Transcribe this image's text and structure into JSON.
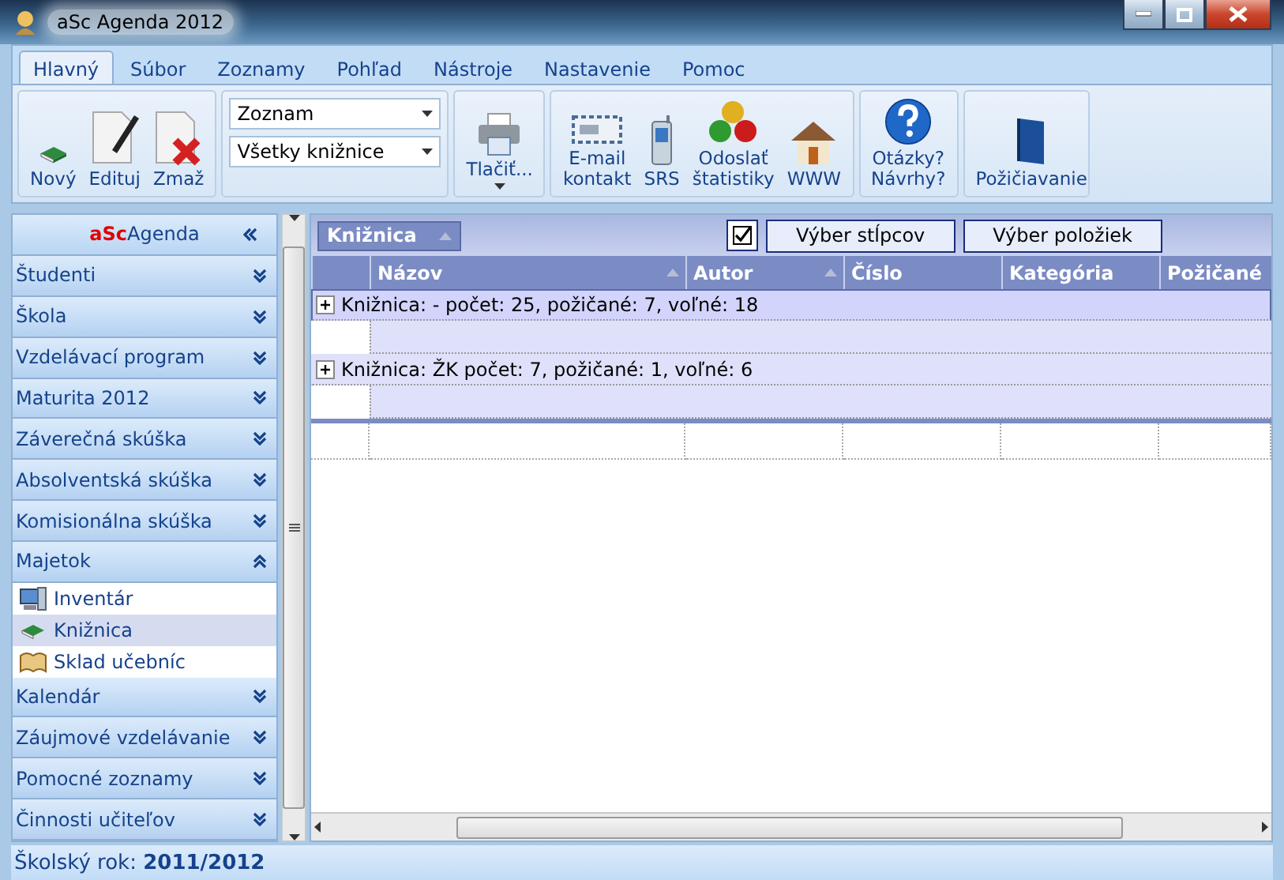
{
  "window": {
    "title": "aSc Agenda 2012"
  },
  "tabs": [
    {
      "label": "Hlavný",
      "selected": true
    },
    {
      "label": "Súbor",
      "selected": false
    },
    {
      "label": "Zoznamy",
      "selected": false
    },
    {
      "label": "Pohľad",
      "selected": false
    },
    {
      "label": "Nástroje",
      "selected": false
    },
    {
      "label": "Nastavenie",
      "selected": false
    },
    {
      "label": "Pomoc",
      "selected": false
    }
  ],
  "ribbon": {
    "edit_buttons": [
      {
        "label": "Nový"
      },
      {
        "label": "Edituj"
      },
      {
        "label": "Zmaž"
      }
    ],
    "dropdowns": [
      {
        "value": "Zoznam"
      },
      {
        "value": "Všetky knižnice"
      }
    ],
    "print_button": {
      "label": "Tlačiť..."
    },
    "send_buttons": [
      {
        "label": "E-mail\nkontakt"
      },
      {
        "label": "SRS"
      },
      {
        "label": "Odoslať\nštatistiky"
      },
      {
        "label": "WWW"
      }
    ],
    "help_button": {
      "label": "Otázky?\nNávrhy?"
    },
    "lending_button": {
      "label": "Požičiavanie"
    }
  },
  "sidebar": {
    "brand_prefix": "aSc",
    "brand": "Agenda",
    "items": [
      {
        "label": "Študenti",
        "expanded": false
      },
      {
        "label": "Škola",
        "expanded": false
      },
      {
        "label": "Vzdelávací program",
        "expanded": false
      },
      {
        "label": "Maturita 2012",
        "expanded": false
      },
      {
        "label": "Záverečná skúška",
        "expanded": false
      },
      {
        "label": "Absolventská skúška",
        "expanded": false
      },
      {
        "label": "Komisionálna skúška",
        "expanded": false
      },
      {
        "label": "Majetok",
        "expanded": true,
        "children": [
          {
            "label": "Inventár",
            "selected": false
          },
          {
            "label": "Knižnica",
            "selected": true
          },
          {
            "label": "Sklad učebníc",
            "selected": false
          }
        ]
      },
      {
        "label": "Kalendár",
        "expanded": false
      },
      {
        "label": "Záujmové vzdelávanie",
        "expanded": false
      },
      {
        "label": "Pomocné zoznamy",
        "expanded": false
      },
      {
        "label": "Činnosti učiteľov",
        "expanded": false
      }
    ]
  },
  "grid": {
    "group_by": "Knižnica",
    "checkbox_checked": true,
    "buttons": [
      "Výber stĺpcov",
      "Výber položiek"
    ],
    "columns": [
      {
        "label": "Názov",
        "sortable": true
      },
      {
        "label": "Autor",
        "sortable": true
      },
      {
        "label": "Číslo",
        "sortable": false
      },
      {
        "label": "Kategória",
        "sortable": false
      },
      {
        "label": "Požičané",
        "sortable": false
      }
    ],
    "groups": [
      {
        "label": "Knižnica: - počet: 25, požičané: 7, voľné: 18",
        "selected": true,
        "expanded": false
      },
      {
        "label": "Knižnica: ŽK počet: 7, požičané: 1, voľné: 6",
        "selected": false,
        "expanded": false
      }
    ]
  },
  "status_bar": "Školský rok: **2011/2012**"
}
